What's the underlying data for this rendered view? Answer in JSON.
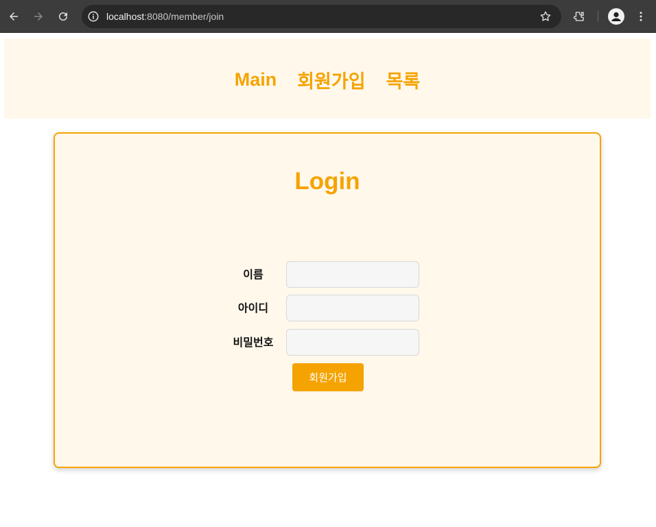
{
  "browser": {
    "url_host": "localhost",
    "url_rest": ":8080/member/join"
  },
  "nav": {
    "main": "Main",
    "join": "회원가입",
    "list": "목록"
  },
  "form": {
    "title": "Login",
    "name_label": "이름",
    "id_label": "아이디",
    "password_label": "비밀번호",
    "submit_label": "회원가입"
  },
  "colors": {
    "accent": "#f5a300",
    "panel_bg": "#fff8eb"
  }
}
